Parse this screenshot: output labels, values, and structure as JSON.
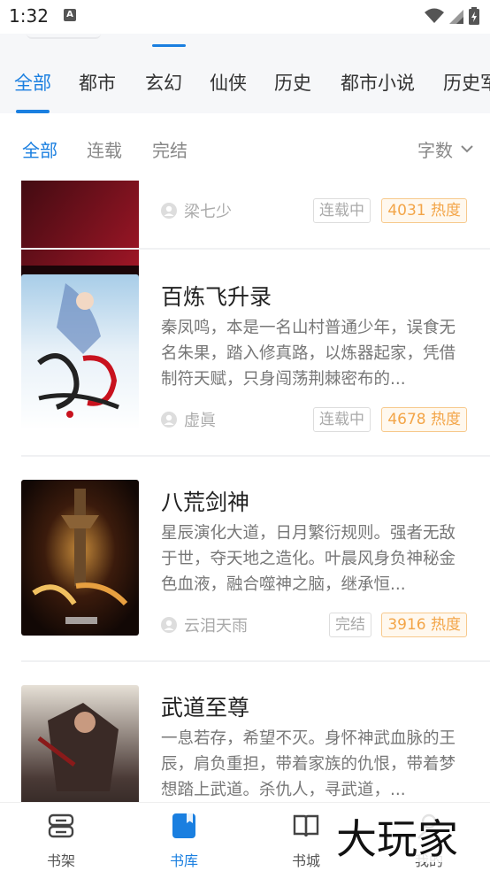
{
  "status_bar": {
    "time": "1:32",
    "notif_letter": "A"
  },
  "category_tabs": [
    {
      "label": "全部",
      "active": true
    },
    {
      "label": "都市",
      "active": false
    },
    {
      "label": "玄幻",
      "active": false
    },
    {
      "label": "仙侠",
      "active": false
    },
    {
      "label": "历史",
      "active": false
    },
    {
      "label": "都市小说",
      "active": false
    },
    {
      "label": "历史军",
      "active": false
    }
  ],
  "filter": {
    "tabs": [
      {
        "label": "全部",
        "active": true
      },
      {
        "label": "连载",
        "active": false
      },
      {
        "label": "完结",
        "active": false
      }
    ],
    "sort_label": "字数"
  },
  "books": [
    {
      "title": "",
      "description": "",
      "author": "梁七少",
      "status": "连载中",
      "heat": "4031 热度",
      "cover_text": "梁七少"
    },
    {
      "title": "百炼飞升录",
      "description": "秦凤鸣，本是一名山村普通少年，误食无名朱果，踏入修真路，以炼器起家，凭借制符天赋，只身闯荡荆棘密布的...",
      "author": "虚眞",
      "status": "连载中",
      "heat": "4678 热度",
      "cover_text": "百炼飞升录",
      "cover_author": "虚眞"
    },
    {
      "title": "八荒剑神",
      "description": "星辰演化大道，日月繁衍规则。强者无敌于世，夺天地之造化。叶晨风身负神秘金色血液，融合噬神之脑，继承恒...",
      "author": "云泪天雨",
      "status": "完结",
      "heat": "3916 热度",
      "cover_text": "八荒剑神",
      "cover_author": "云泪天雨"
    },
    {
      "title": "武道至尊",
      "description": "一息若存，希望不灭。身怀神武血脉的王辰，肩负重担，带着家族的仇恨，带着梦想踏上武道。杀仇人，寻武道，...",
      "author": "",
      "status": "",
      "heat": "",
      "cover_text": "武道至尊"
    }
  ],
  "bottom_nav": [
    {
      "label": "书架",
      "icon": "shelf-icon",
      "active": false
    },
    {
      "label": "书库",
      "icon": "library-icon",
      "active": true
    },
    {
      "label": "书城",
      "icon": "book-icon",
      "active": false
    },
    {
      "label": "我的",
      "icon": "user-icon",
      "active": false
    }
  ],
  "watermark": "大玩家",
  "colors": {
    "accent": "#1a7fe0",
    "heat": "#f3a548",
    "muted": "#888888"
  }
}
